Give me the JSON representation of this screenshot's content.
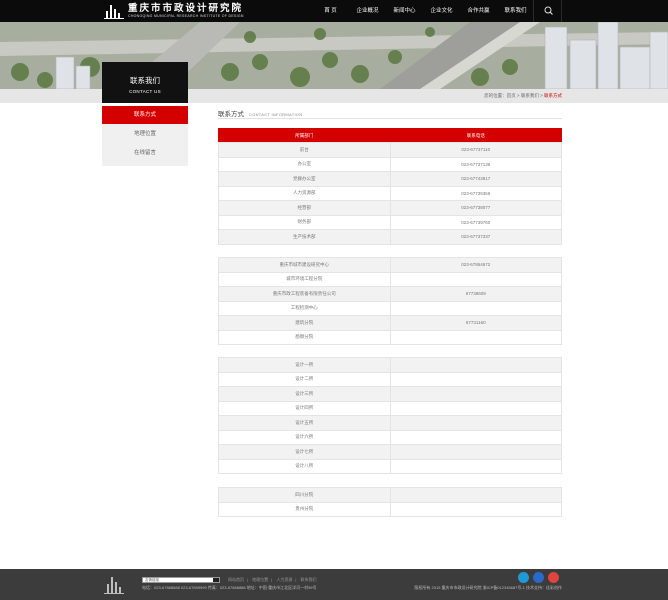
{
  "header": {
    "logo_cn": "重庆市市政设计研究院",
    "logo_en": "CHONGQING MUNICIPAL RESEARCH INSTITUTE OF DESIGN",
    "nav": [
      "首 页",
      "企业概况",
      "新闻中心",
      "企业文化",
      "合作共赢",
      "联系我们"
    ]
  },
  "sidebar": {
    "title_cn": "联系我们",
    "title_en": "CONTACT US",
    "items": [
      {
        "label": "联系方式",
        "active": true
      },
      {
        "label": "地理位置",
        "active": false
      },
      {
        "label": "在线留言",
        "active": false
      }
    ]
  },
  "breadcrumb": {
    "prefix": "您的位置：",
    "home": "首页",
    "sep": ">",
    "parent": "联系我们",
    "current": "联系方式"
  },
  "section": {
    "title": "联系方式",
    "title_en": "CONTACT INFORMATION"
  },
  "table": {
    "headers": [
      "所属部门",
      "联系电话"
    ],
    "groups": [
      [
        [
          "前台",
          "023-67737110"
        ],
        [
          "办公室",
          "023-67737136"
        ],
        [
          "党群办公室",
          "023-67743817"
        ],
        [
          "人力资源部",
          "023-67739356"
        ],
        [
          "经营部",
          "023-67738077"
        ],
        [
          "财务部",
          "023-67739760"
        ],
        [
          "生产技术部",
          "023-67737337"
        ]
      ],
      [
        [
          "重庆市城市建设研究中心",
          "023-67864672"
        ],
        [
          "城市环境工程分院",
          ""
        ],
        [
          "重庆市政工程装备有限责任公司",
          "67738609"
        ],
        [
          "工程检测中心",
          ""
        ],
        [
          "建筑分院",
          "67731160"
        ],
        [
          "勘察分院",
          ""
        ]
      ],
      [
        [
          "设计一所",
          ""
        ],
        [
          "设计二所",
          ""
        ],
        [
          "设计三所",
          ""
        ],
        [
          "设计四所",
          ""
        ],
        [
          "设计五所",
          ""
        ],
        [
          "设计六所",
          ""
        ],
        [
          "设计七所",
          ""
        ],
        [
          "设计八所",
          ""
        ]
      ],
      [
        [
          "四川分院",
          ""
        ],
        [
          "贵州分院",
          ""
        ]
      ]
    ]
  },
  "footer": {
    "select_placeholder": "友情链接",
    "links": [
      "网站首页",
      "地理位置",
      "人力资源",
      "联系我们"
    ],
    "contact": "电话：023-67888888 023-67899999 传真：023-67888888 地址：中国·重庆市江北区洋河一村99号",
    "copyright": "版权所有 2015 重庆市市政设计研究院 渝ICP备012345687号-1 技术支持：佳彩创作"
  },
  "colors": {
    "accent": "#d40000",
    "topbar": "#0b0b0b",
    "footer": "#3c3c3c"
  },
  "icons": {
    "search": "search-icon",
    "qq": "qq-icon",
    "social_blue": "tencent-weibo-icon",
    "weibo": "weibo-icon"
  }
}
